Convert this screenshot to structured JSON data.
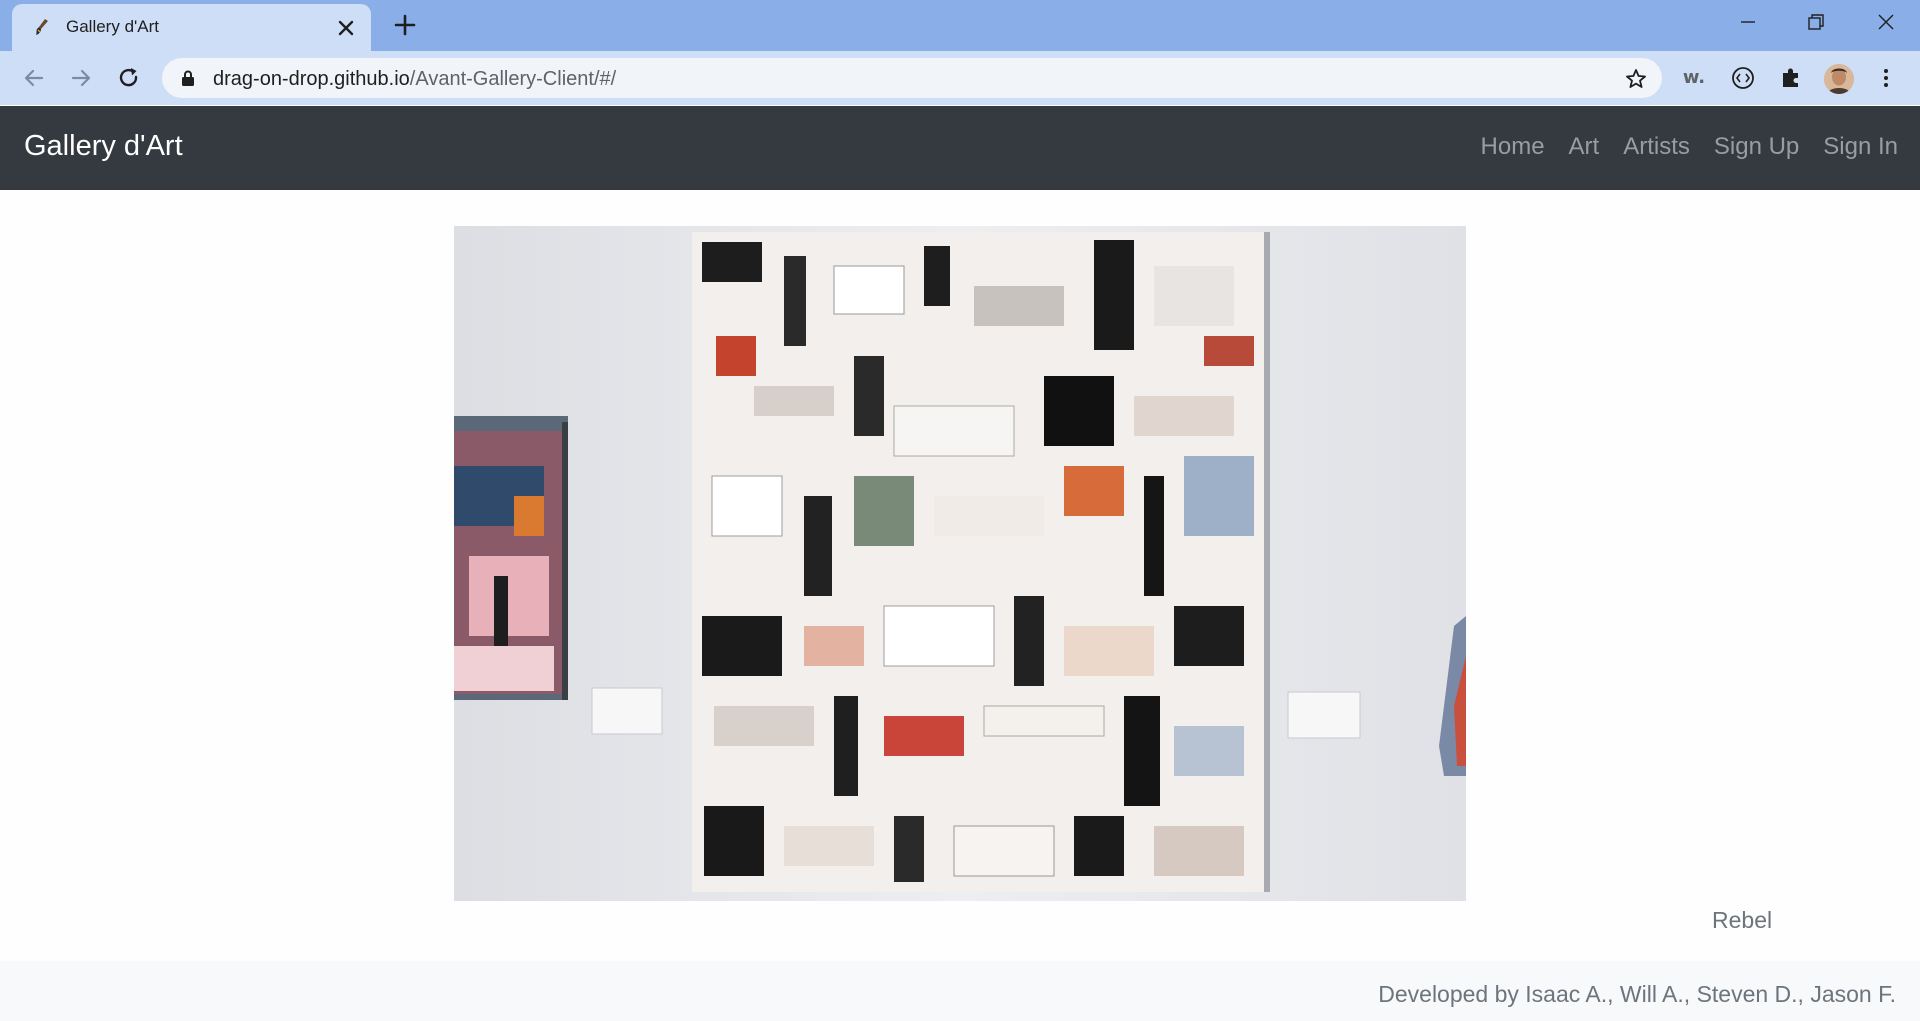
{
  "browser": {
    "tab_title": "Gallery d'Art",
    "url_host": "drag-on-drop.github.io",
    "url_path": "/Avant-Gallery-Client/#/",
    "extension_w": "w."
  },
  "site": {
    "brand": "Gallery d'Art",
    "nav": [
      "Home",
      "Art",
      "Artists",
      "Sign Up",
      "Sign In"
    ]
  },
  "artwork": {
    "title": "Rebel"
  },
  "footer": {
    "credits": "Developed by Isaac A., Will A., Steven D., Jason F."
  },
  "colors": {
    "tabstrip": "#89aee8",
    "toolbar": "#cedef7",
    "navbar": "#343a40",
    "muted_text": "#6c757d"
  }
}
